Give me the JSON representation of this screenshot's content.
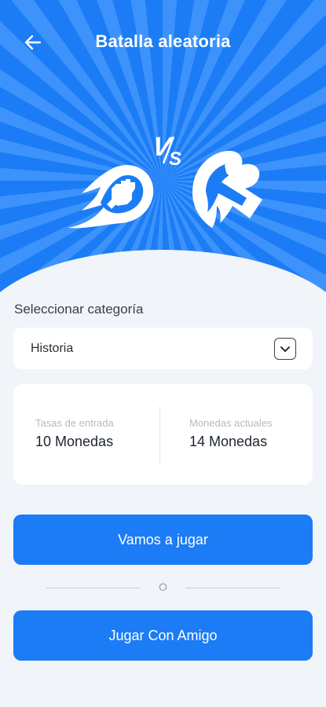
{
  "header": {
    "title": "Batalla aleatoria",
    "back_icon": "arrow-left-icon"
  },
  "hero": {
    "vs_text": "VS",
    "left_icon": "fist-fireball-icon",
    "right_icon": "hand-flame-icon",
    "colors": {
      "blue": "#1b7cf6",
      "ray_light": "#4a9bff",
      "white": "#ffffff"
    }
  },
  "category": {
    "label": "Seleccionar categoría",
    "selected": "Historia",
    "toggle_icon": "chevron-down-icon"
  },
  "info": {
    "entry_fee_label": "Tasas de entrada",
    "entry_fee_value": "10 Monedas",
    "current_coins_label": "Monedas actuales",
    "current_coins_value": "14 Monedas"
  },
  "actions": {
    "play_label": "Vamos a jugar",
    "or_label": "O",
    "friend_label": "Jugar Con Amigo"
  }
}
